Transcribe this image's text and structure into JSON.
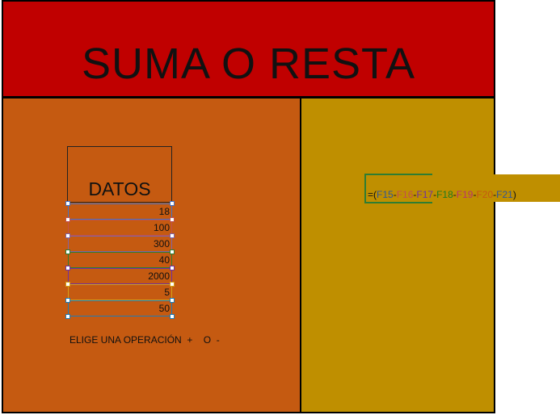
{
  "title": "SUMA O RESTA",
  "datos": {
    "header": "DATOS",
    "values": [
      "18",
      "100",
      "300",
      "40",
      "2000",
      "5",
      "50"
    ],
    "border_colors": [
      "#4472c4",
      "#c0504d",
      "#8064a2",
      "#2e7d32",
      "#7030a0",
      "#d4a017",
      "#1f7bb6"
    ]
  },
  "operation_label": "ELIGE UNA OPERACIÓN  +    O  -",
  "formula": {
    "tokens": [
      {
        "text": "=(",
        "color": "#111111"
      },
      {
        "text": "F15",
        "color": "#2f5597"
      },
      {
        "text": "-",
        "color": "#111111"
      },
      {
        "text": "F16",
        "color": "#c0504d"
      },
      {
        "text": "-",
        "color": "#111111"
      },
      {
        "text": "F17",
        "color": "#7030a0"
      },
      {
        "text": "-",
        "color": "#111111"
      },
      {
        "text": "F18",
        "color": "#1e7b1e"
      },
      {
        "text": "-",
        "color": "#111111"
      },
      {
        "text": "F19",
        "color": "#b8336a"
      },
      {
        "text": "-",
        "color": "#111111"
      },
      {
        "text": "F20",
        "color": "#c55a11"
      },
      {
        "text": "-",
        "color": "#111111"
      },
      {
        "text": "F21",
        "color": "#2f5597"
      },
      {
        "text": ")",
        "color": "#111111"
      }
    ]
  },
  "colors": {
    "title_band": "#c00000",
    "left_panel": "#c55a11",
    "right_panel": "#bf8f00"
  }
}
